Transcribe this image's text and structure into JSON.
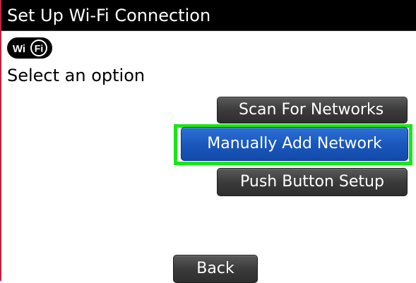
{
  "title": "Set Up Wi-Fi Connection",
  "logo": {
    "left_text": "Wi",
    "right_text": "Fi"
  },
  "prompt": "Select an option",
  "buttons": {
    "scan": "Scan For Networks",
    "manual": "Manually Add Network",
    "push": "Push Button Setup",
    "back": "Back"
  },
  "colors": {
    "titlebar": "#000000",
    "button": "#3b3b3b",
    "selected_button": "#1a58be",
    "focus_ring": "#19e619"
  }
}
